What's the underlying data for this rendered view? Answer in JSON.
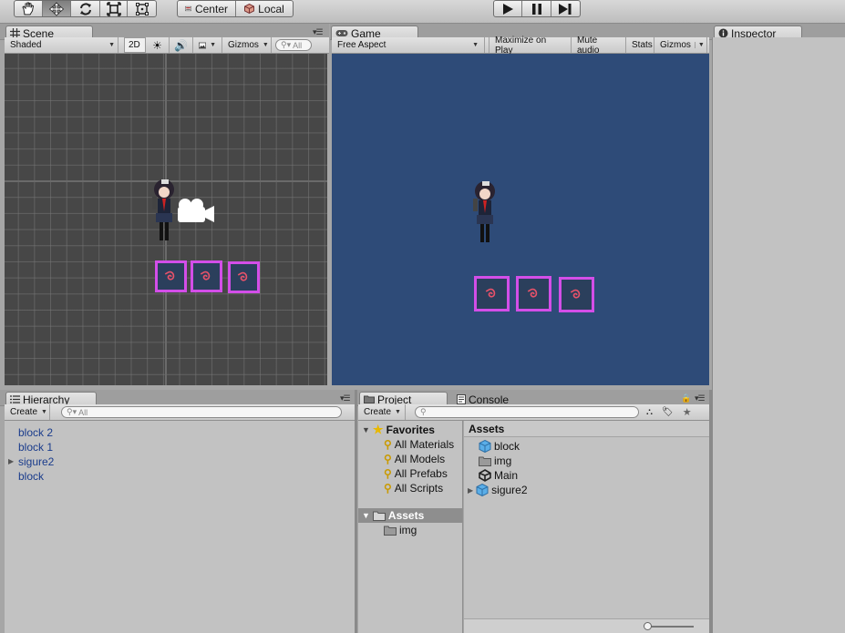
{
  "toolbar": {
    "tools": [
      "hand-tool",
      "move-tool",
      "rotate-tool",
      "scale-tool",
      "rect-tool"
    ],
    "pivot_center": "Center",
    "pivot_local": "Local",
    "play": [
      "play",
      "pause",
      "step"
    ]
  },
  "scene": {
    "tab": "Scene",
    "shading": "Shaded",
    "mode_2d": "2D",
    "gizmos": "Gizmos",
    "search_placeholder": "All"
  },
  "game": {
    "tab": "Game",
    "aspect": "Free Aspect",
    "maximize": "Maximize on Play",
    "mute": "Mute audio",
    "stats": "Stats",
    "gizmos": "Gizmos"
  },
  "inspector": {
    "tab": "Inspector"
  },
  "hierarchy": {
    "tab": "Hierarchy",
    "create": "Create",
    "search_placeholder": "All",
    "items": [
      {
        "label": "block 2",
        "expandable": false
      },
      {
        "label": "block 1",
        "expandable": false
      },
      {
        "label": "sigure2",
        "expandable": true
      },
      {
        "label": "block",
        "expandable": false
      }
    ]
  },
  "project": {
    "tab": "Project",
    "console_tab": "Console",
    "create": "Create",
    "favorites": {
      "label": "Favorites",
      "items": [
        "All Materials",
        "All Models",
        "All Prefabs",
        "All Scripts"
      ]
    },
    "tree_assets": "Assets",
    "tree_img": "img",
    "assets_header": "Assets",
    "assets": [
      {
        "label": "block",
        "icon": "prefab-icon"
      },
      {
        "label": "img",
        "icon": "folder-icon"
      },
      {
        "label": "Main",
        "icon": "unity-scene-icon"
      },
      {
        "label": "sigure2",
        "icon": "prefab-icon"
      }
    ]
  },
  "colors": {
    "scene_bg": "#474747",
    "game_bg": "#2e4b78",
    "block_border": "#d34ee8",
    "hierarchy_text": "#1a3c8c"
  }
}
